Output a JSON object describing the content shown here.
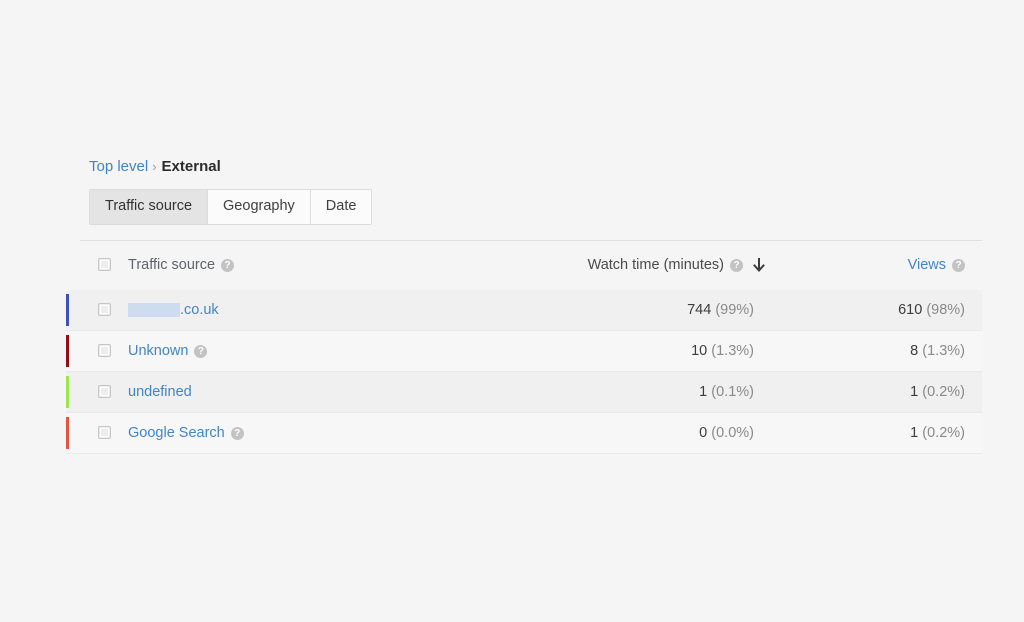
{
  "breadcrumb": {
    "root_label": "Top level",
    "separator": "›",
    "current_label": "External"
  },
  "tabs": [
    {
      "label": "Traffic source",
      "active": true
    },
    {
      "label": "Geography",
      "active": false
    },
    {
      "label": "Date",
      "active": false
    }
  ],
  "table": {
    "columns": {
      "source": {
        "label": "Traffic source",
        "has_help": true
      },
      "watch_time": {
        "label": "Watch time (minutes)",
        "has_help": true,
        "sorted": true,
        "sort_direction": "desc",
        "sort_glyph": "down-arrow"
      },
      "views": {
        "label": "Views",
        "has_help": true,
        "is_link": true
      }
    },
    "help_glyph": "?",
    "select_all_checkbox": {
      "checked": false
    },
    "rows": [
      {
        "label": ".co.uk",
        "redacted_prefix": true,
        "has_help": false,
        "bar_color": "#3f51b5",
        "watch_time": "744",
        "watch_time_pct": "(99%)",
        "views": "610",
        "views_pct": "(98%)",
        "checked": false
      },
      {
        "label": "Unknown",
        "redacted_prefix": false,
        "has_help": true,
        "bar_color": "#8e1016",
        "watch_time": "10",
        "watch_time_pct": "(1.3%)",
        "views": "8",
        "views_pct": "(1.3%)",
        "checked": false
      },
      {
        "label": "undefined",
        "redacted_prefix": false,
        "has_help": false,
        "bar_color": "#9ce74e",
        "watch_time": "1",
        "watch_time_pct": "(0.1%)",
        "views": "1",
        "views_pct": "(0.2%)",
        "checked": false
      },
      {
        "label": "Google Search",
        "redacted_prefix": false,
        "has_help": true,
        "bar_color": "#e0563f",
        "watch_time": "0",
        "watch_time_pct": "(0.0%)",
        "views": "1",
        "views_pct": "(0.2%)",
        "checked": false
      }
    ]
  },
  "colors": {
    "background": "#f5f5f5",
    "link": "#4285c5",
    "text": "#333333",
    "muted": "#8a8a8a",
    "row_alt_a": "#f0f0f0",
    "row_alt_b": "#f7f7f7",
    "divider": "#e0e0e0",
    "redaction": "#cddcee"
  }
}
